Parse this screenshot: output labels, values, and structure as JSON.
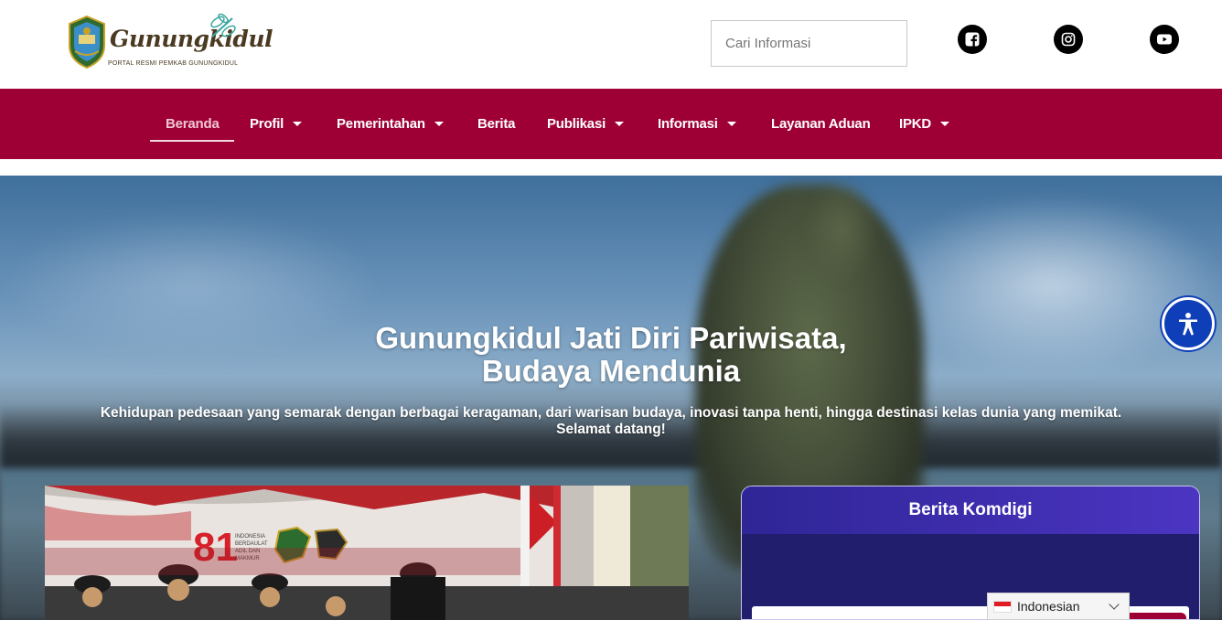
{
  "header": {
    "logo_title": "Gunungkidul",
    "logo_subtitle": "PORTAL RESMI PEMKAB GUNUNGKIDUL",
    "search_placeholder": "Cari Informasi",
    "social": [
      "facebook-icon",
      "instagram-icon",
      "youtube-icon"
    ]
  },
  "nav": {
    "items": [
      {
        "label": "Beranda",
        "dropdown": false,
        "active": true
      },
      {
        "label": "Profil",
        "dropdown": true
      },
      {
        "label": "Pemerintahan",
        "dropdown": true
      },
      {
        "label": "Berita",
        "dropdown": false
      },
      {
        "label": "Publikasi",
        "dropdown": true
      },
      {
        "label": "Informasi",
        "dropdown": true
      },
      {
        "label": "Layanan Aduan",
        "dropdown": false
      },
      {
        "label": "IPKD",
        "dropdown": true
      }
    ]
  },
  "hero": {
    "title_line1": "Gunungkidul Jati Diri Pariwisata,",
    "title_line2": "Budaya Mendunia",
    "subtitle_line1": "Kehidupan pedesaan yang semarak dengan berbagai keragaman, dari warisan budaya, inovasi tanpa henti, hingga destinasi kelas dunia yang memikat.",
    "subtitle_line2": "Selamat datang!"
  },
  "news_photo": {
    "banner_number": "81",
    "banner_text": [
      "INDONESIA",
      "BERDAULAT",
      "ADIL DAN",
      "MAKMUR"
    ]
  },
  "komdigi": {
    "title": "Berita Komdigi"
  },
  "language": {
    "selected": "Indonesian"
  },
  "colors": {
    "nav_bg": "#9e0036",
    "komdigi_header": "#3a2aa8",
    "accessibility": "#0f3fb8"
  }
}
